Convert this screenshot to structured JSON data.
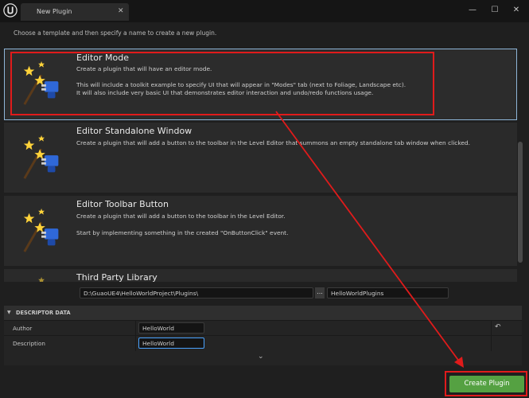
{
  "window": {
    "tab_title": "New Plugin",
    "tab_close": "✕",
    "minimize": "—",
    "maximize": "☐",
    "close": "✕"
  },
  "subtitle": "Choose a template and then specify a name to create a new plugin.",
  "templates": [
    {
      "title": "Editor Mode",
      "desc": [
        "Create a plugin that will have an editor mode.",
        "",
        "This will include a toolkit example to specify UI that will appear in \"Modes\" tab (next to Foliage, Landscape etc).",
        "It will also include very basic UI that demonstrates editor interaction and undo/redo functions usage."
      ],
      "selected": true
    },
    {
      "title": "Editor Standalone Window",
      "desc": [
        "Create a plugin that will add a button to the toolbar in the Level Editor that summons an empty standalone tab window when clicked."
      ],
      "selected": false
    },
    {
      "title": "Editor Toolbar Button",
      "desc": [
        "Create a plugin that will add a button to the toolbar in the Level Editor.",
        "",
        "Start by implementing something in the created \"OnButtonClick\" event."
      ],
      "selected": false
    },
    {
      "title": "Third Party Library",
      "desc": [],
      "selected": false
    }
  ],
  "path": {
    "value": "D:\\GuaoUE4\\HelloWorldProject\\Plugins\\",
    "browse_label": "...",
    "plugin_name": "HelloWorldPlugins"
  },
  "descriptor": {
    "header": "DESCRIPTOR DATA",
    "rows": [
      {
        "label": "Author",
        "value": "HelloWorld"
      },
      {
        "label": "Description",
        "value": "HelloWorld"
      }
    ],
    "reset_glyph": "↶",
    "expand_glyph": "⌄"
  },
  "create_button": "Create Plugin",
  "colors": {
    "accent_green": "#55a142",
    "annotation_red": "#e01b1b",
    "selection_outline": "#8fb6d9",
    "focus_blue": "#4aa3ff"
  },
  "icons": {
    "app_logo": "unreal-engine-logo-icon",
    "template_thumbnail": "magic-wand-plug-icon"
  }
}
